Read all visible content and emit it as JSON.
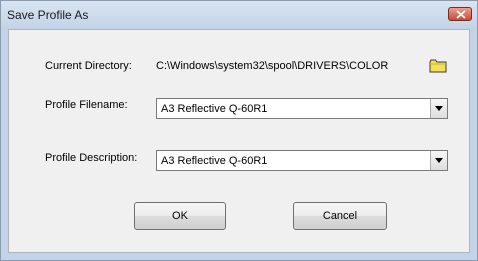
{
  "window": {
    "title": "Save Profile As"
  },
  "form": {
    "current_directory_label": "Current Directory:",
    "current_directory_value": "C:\\Windows\\system32\\spool\\DRIVERS\\COLOR",
    "profile_filename_label": "Profile Filename:",
    "profile_filename_value": "A3 Reflective Q-60R1",
    "profile_description_label": "Profile Description:",
    "profile_description_value": "A3 Reflective Q-60R1"
  },
  "buttons": {
    "ok_label": "OK",
    "cancel_label": "Cancel"
  },
  "icons": {
    "close": "close-icon",
    "folder": "folder-icon",
    "dropdown": "chevron-down-icon"
  },
  "colors": {
    "close_button": "#c64b36",
    "folder": "#f2e05a"
  }
}
